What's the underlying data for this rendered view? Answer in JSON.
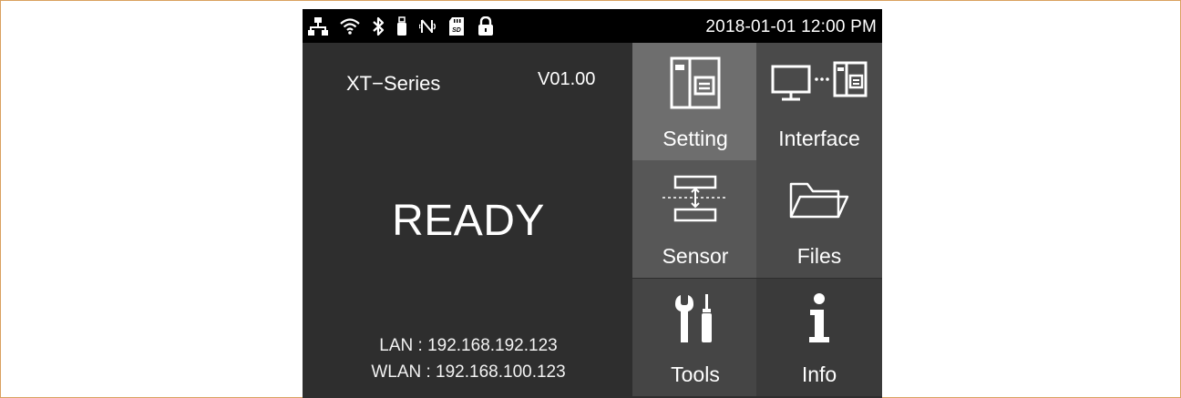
{
  "status_bar": {
    "datetime": "2018-01-01 12:00 PM",
    "icons": [
      "lan-icon",
      "wifi-icon",
      "bluetooth-icon",
      "usb-icon",
      "nfc-icon",
      "sd-card-icon",
      "lock-icon"
    ],
    "sd_label": "SD"
  },
  "info_panel": {
    "model": "XT−Series",
    "version": "V01.00",
    "status": "READY",
    "lan": "LAN : 192.168.192.123",
    "wlan": "WLAN : 192.168.100.123"
  },
  "menu": {
    "setting": "Setting",
    "interface": "Interface",
    "sensor": "Sensor",
    "files": "Files",
    "tools": "Tools",
    "info": "Info"
  },
  "colors": {
    "status_bar_bg": "#000000",
    "panel_bg": "#2e2e2e",
    "selected_tile": "#6e6e6e",
    "frame_border": "#d9a15f"
  }
}
